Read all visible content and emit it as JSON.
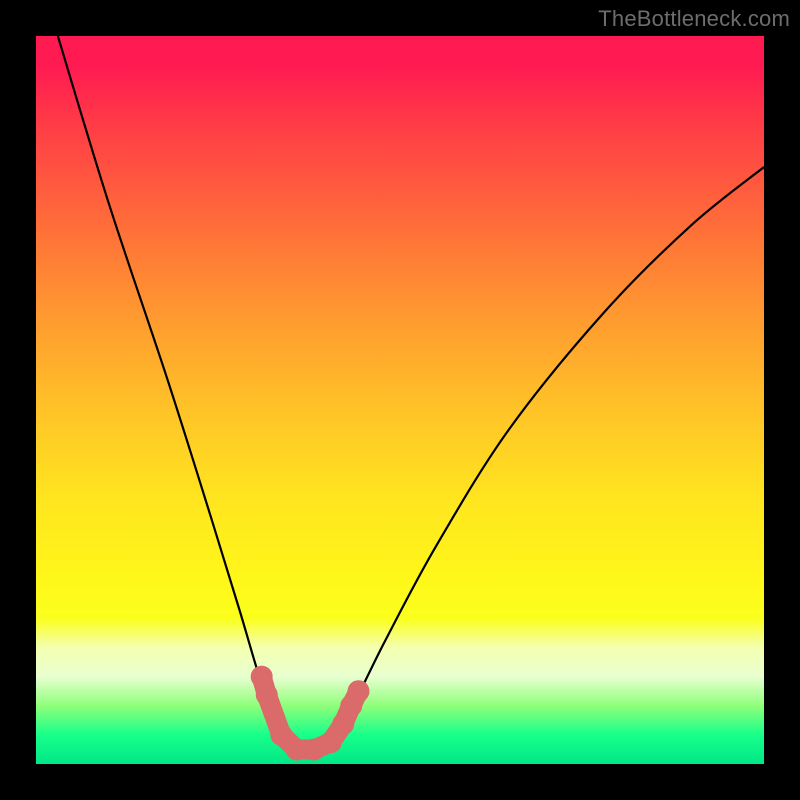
{
  "watermark": "TheBottleneck.com",
  "chart_data": {
    "type": "line",
    "title": "",
    "xlabel": "",
    "ylabel": "",
    "xlim": [
      0,
      100
    ],
    "ylim": [
      0,
      100
    ],
    "series": [
      {
        "name": "bottleneck-curve",
        "x": [
          3,
          10,
          18,
          24,
          28,
          31,
          33.5,
          35.5,
          38,
          41,
          44,
          48,
          55,
          65,
          78,
          90,
          100
        ],
        "values": [
          100,
          77,
          53,
          34,
          21,
          11,
          5,
          2,
          2,
          4,
          9,
          17,
          30,
          46,
          62,
          74,
          82
        ]
      }
    ],
    "markers": {
      "name": "highlight-band",
      "color": "#db6a6a",
      "points": [
        {
          "x": 31.0,
          "y": 12.0
        },
        {
          "x": 31.7,
          "y": 9.5
        },
        {
          "x": 33.7,
          "y": 4.0
        },
        {
          "x": 35.8,
          "y": 2.0
        },
        {
          "x": 38.2,
          "y": 2.0
        },
        {
          "x": 40.5,
          "y": 3.0
        },
        {
          "x": 42.2,
          "y": 5.5
        },
        {
          "x": 43.3,
          "y": 8.0
        },
        {
          "x": 44.3,
          "y": 10.0
        }
      ]
    },
    "color_axis": {
      "orientation": "vertical",
      "stops": [
        {
          "pos": 0.0,
          "color": "#ff1a52"
        },
        {
          "pos": 0.5,
          "color": "#ffd423"
        },
        {
          "pos": 0.82,
          "color": "#f7ff7a"
        },
        {
          "pos": 1.0,
          "color": "#00e887"
        }
      ]
    }
  }
}
